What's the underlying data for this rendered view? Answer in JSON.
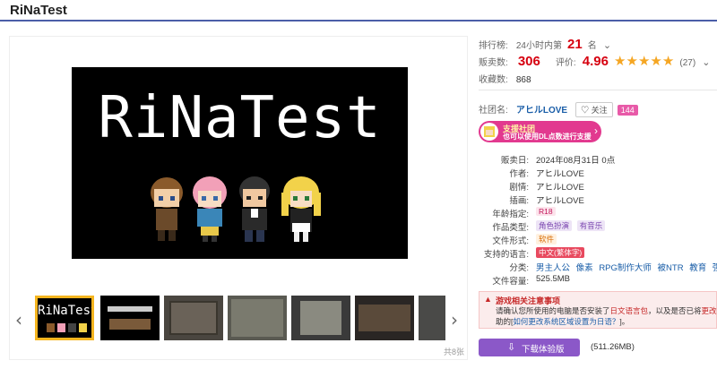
{
  "title": "RiNaTest",
  "gallery": {
    "main_image_text": "RiNaTest",
    "thumb_text": "RiNaTest",
    "prev_arrow": "‹",
    "next_arrow": "›",
    "count_label": "共8张"
  },
  "ranking": {
    "label": "排行榜:",
    "period": "24小时内第",
    "rank": "21",
    "unit": "名"
  },
  "sales": {
    "label": "贩卖数:",
    "value": "306",
    "rating_label": "评价:",
    "rating_value": "4.96",
    "stars": "★★★★★",
    "rating_count": "(27)"
  },
  "favorites": {
    "label": "收藏数:",
    "value": "868"
  },
  "circle": {
    "label": "社团名:",
    "name": "アヒルLOVE",
    "follow_label": "关注",
    "follow_count": "144"
  },
  "support": {
    "line1": "支援社团",
    "line2": "也可以使用DL点数进行支援"
  },
  "specs": {
    "release_date_label": "贩卖日:",
    "release_date": "2024年08月31日 0点",
    "author_label": "作者:",
    "author": "アヒルLOVE",
    "scenario_label": "剧情:",
    "scenario": "アヒルLOVE",
    "illust_label": "插画:",
    "illust": "アヒルLOVE",
    "age_label": "年龄指定:",
    "age": "R18",
    "type_label": "作品类型:",
    "types": [
      "角色扮演",
      "有音乐"
    ],
    "format_label": "文件形式:",
    "format": "软件",
    "lang_label": "支持的语言:",
    "lang": "中文(繁体字)",
    "genre_label": "分类:",
    "genres": [
      "男主人公",
      "像素",
      "RPG制作大师",
      "被NTR",
      "教育",
      "强X"
    ],
    "size_label": "文件容量:",
    "size": "525.5MB"
  },
  "notice": {
    "title": "游戏相关注意事项",
    "line1_a": "请确认您所使用的电脑是否安装了",
    "line1_b": "日文语言包",
    "line1_c": "，以及是否已将",
    "line1_d": "更改系统",
    "line2_a": "助的[",
    "line2_b": "如何更改系统区域设置为日语？",
    "line2_c": "]。"
  },
  "download": {
    "label": "下载体验版",
    "size": "(511.26MB)"
  },
  "colors": {
    "accent_red": "#d6000f",
    "star": "#f5a623",
    "support_pink": "#e2398f",
    "download_purple": "#8b58c8",
    "link_blue": "#1a5ea8"
  }
}
